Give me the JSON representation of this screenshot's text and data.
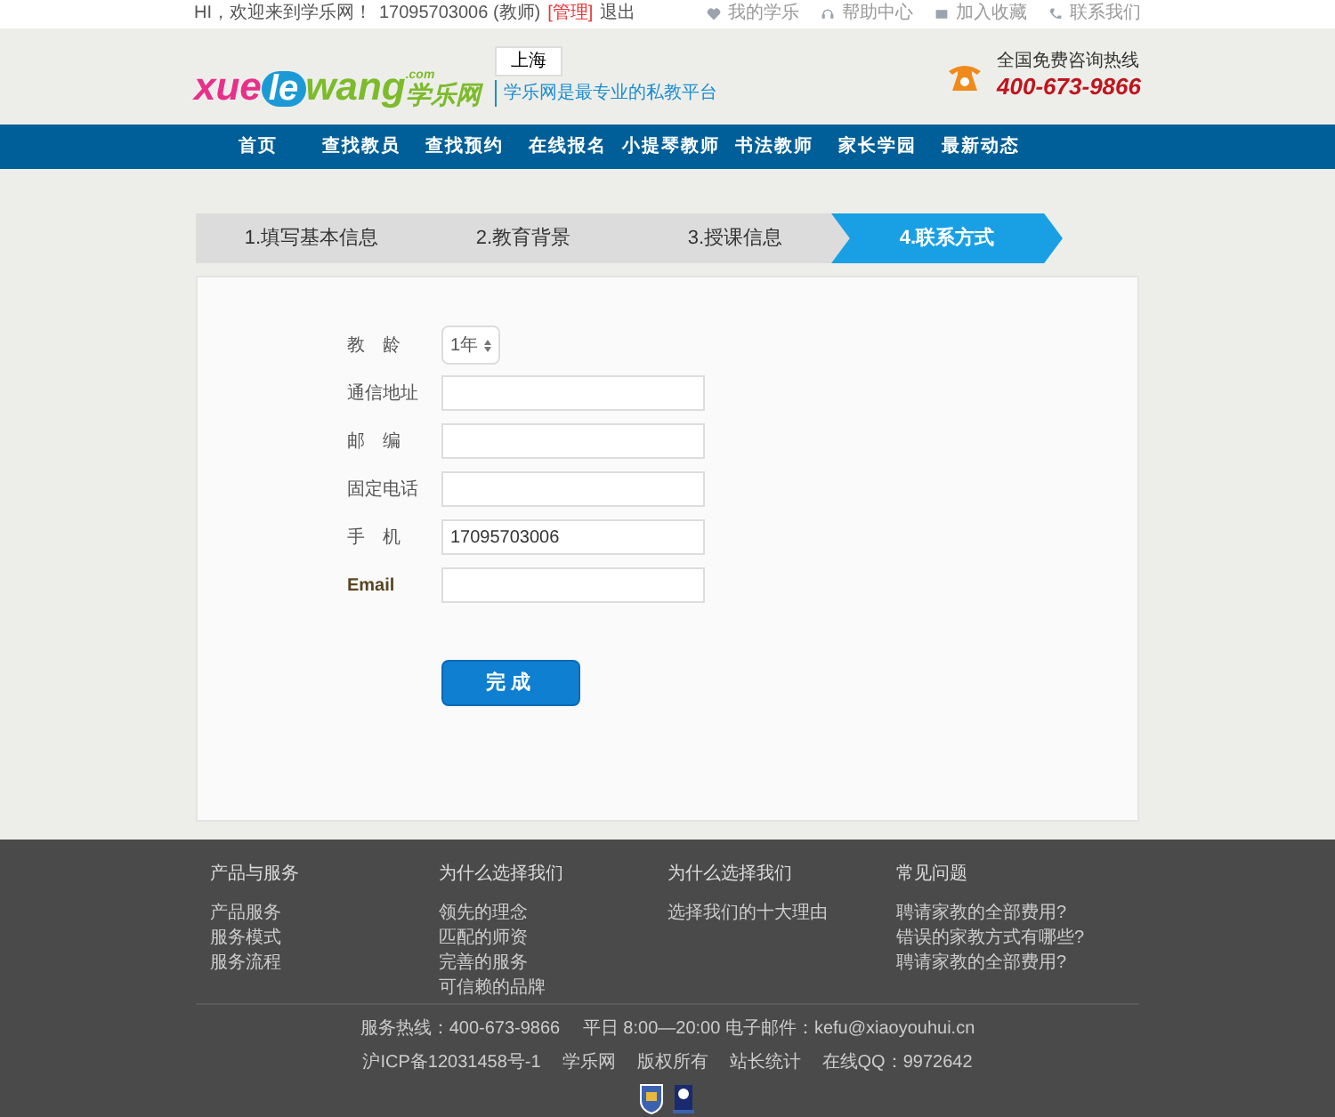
{
  "top_bar": {
    "greeting": "HI，欢迎来到学乐网！",
    "user": "17095703006 (教师)",
    "admin_link": "[管理]",
    "logout_link": "退出",
    "links": [
      "我的学乐",
      "帮助中心",
      "加入收藏",
      "联系我们"
    ]
  },
  "header": {
    "logo": {
      "part_1": "xue",
      "part_2": "le",
      "part_3": "wang",
      "domain": ".com",
      "name": "学乐网"
    },
    "city": "上海",
    "slogan": "学乐网是最专业的私教平台",
    "hotline_label": "全国免费咨询热线",
    "hotline": "400-673-9866"
  },
  "nav": [
    "首页",
    "查找教员",
    "查找预约",
    "在线报名",
    "小提琴教师",
    "书法教师",
    "家长学园",
    "最新动态"
  ],
  "steps": [
    {
      "label": "1.填写基本信息",
      "selected": false
    },
    {
      "label": "2.教育背景",
      "selected": false
    },
    {
      "label": "3.授课信息",
      "selected": false
    },
    {
      "label": "4.联系方式",
      "selected": true
    }
  ],
  "form": {
    "fields": [
      {
        "kind": "select",
        "label": "教　龄",
        "value": "1年"
      },
      {
        "kind": "input",
        "label": "通信地址"
      },
      {
        "kind": "input",
        "label": "邮　编"
      },
      {
        "kind": "input",
        "label": "固定电话"
      },
      {
        "kind": "input",
        "label": "手　机",
        "value": "17095703006"
      },
      {
        "kind": "input",
        "label": "Email"
      }
    ],
    "submit": "完成"
  },
  "footer": {
    "columns": [
      {
        "title": "产品与服务",
        "links": [
          "产品服务",
          "服务模式",
          "服务流程"
        ]
      },
      {
        "title": "为什么选择我们",
        "links": [
          "领先的理念",
          "匹配的师资",
          "完善的服务",
          "可信赖的品牌"
        ]
      },
      {
        "title": "为什么选择我们",
        "links": [
          "选择我们的十大理由"
        ]
      },
      {
        "title": "常见问题",
        "links": [
          "聘请家教的全部费用?",
          "错误的家教方式有哪些?",
          "聘请家教的全部费用?"
        ]
      }
    ],
    "contact_line": "服务热线：400-673-9866　 平日 8:00—20:00 电子邮件：kefu@xiaoyouhui.cn",
    "info_line": [
      "沪ICP备12031458号-1",
      "学乐网",
      "版权所有",
      "站长统计",
      "在线QQ：9972642"
    ]
  }
}
